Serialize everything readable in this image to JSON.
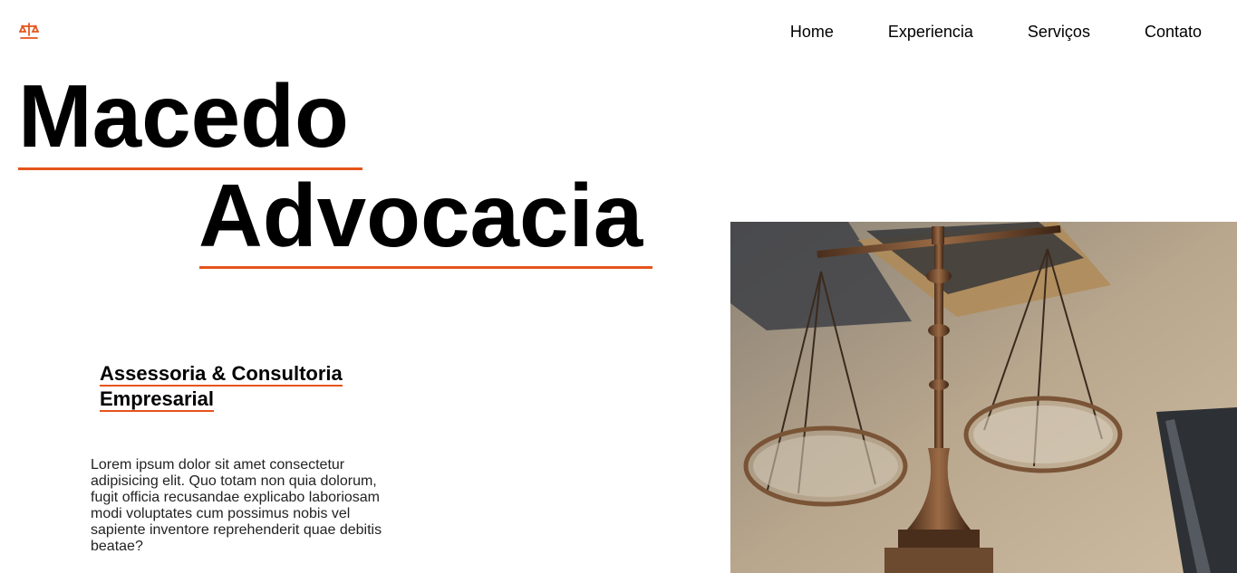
{
  "header": {
    "logo_icon": "scales-of-justice-icon",
    "accent_color": "#e5541b",
    "nav": [
      {
        "label": "Home"
      },
      {
        "label": "Experiencia"
      },
      {
        "label": "Serviços"
      },
      {
        "label": "Contato"
      }
    ]
  },
  "hero": {
    "title_line1": "Macedo",
    "title_line2": "Advocacia",
    "subtitle": "Assessoria & Consultoria Empresarial",
    "body": "Lorem ipsum dolor sit amet consectetur adipisicing elit. Quo totam non quia dolorum, fugit officia recusandae explicabo laboriosam modi voluptates cum possimus nobis vel sapiente inventore reprehenderit quae debitis beatae?",
    "image_icon": "scales-of-justice-photo"
  }
}
